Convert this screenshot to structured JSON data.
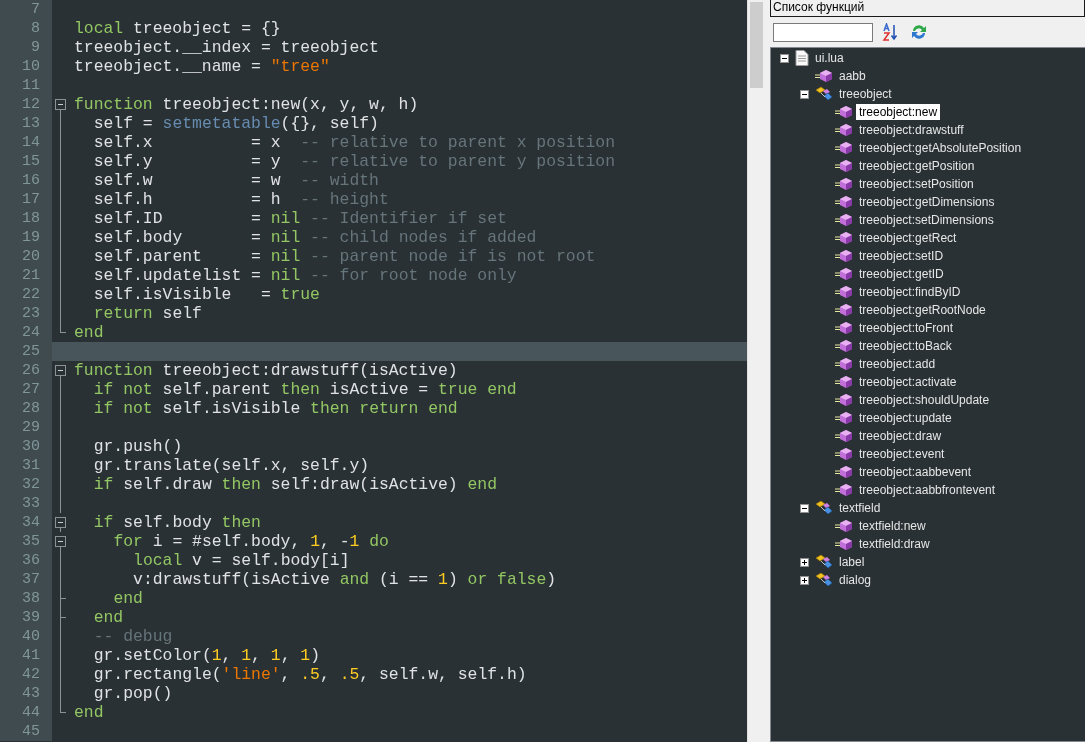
{
  "editor": {
    "lines": [
      {
        "number": "7",
        "current": false
      },
      {
        "number": "8",
        "current": false,
        "tokens": [
          {
            "kind": "kw",
            "text": "local"
          },
          {
            "kind": "plain",
            "text": " treeobject = {}"
          }
        ]
      },
      {
        "number": "9",
        "current": false,
        "tokens": [
          {
            "kind": "plain",
            "text": "treeobject.__index = treeobject"
          }
        ]
      },
      {
        "number": "10",
        "current": false,
        "tokens": [
          {
            "kind": "plain",
            "text": "treeobject.__name = "
          },
          {
            "kind": "str",
            "text": "\"tree\""
          }
        ]
      },
      {
        "number": "11",
        "current": false
      },
      {
        "number": "12",
        "current": false,
        "tokens": [
          {
            "kind": "kw",
            "text": "function"
          },
          {
            "kind": "plain",
            "text": " treeobject:new(x, y, w, h)"
          }
        ],
        "children": [
          {
            "number": "13",
            "current": false,
            "tokens": [
              {
                "kind": "plain",
                "text": "self = "
              },
              {
                "kind": "fn",
                "text": "setmetatable"
              },
              {
                "kind": "plain",
                "text": "({}, self)"
              }
            ]
          },
          {
            "number": "14",
            "current": false,
            "tokens": [
              {
                "kind": "plain",
                "text": "self.x          = x"
              },
              {
                "kind": "cmt",
                "text": "  -- relative to parent x position"
              }
            ]
          },
          {
            "number": "15",
            "current": false,
            "tokens": [
              {
                "kind": "plain",
                "text": "self.y          = y"
              },
              {
                "kind": "cmt",
                "text": "  -- relative to parent y position"
              }
            ]
          },
          {
            "number": "16",
            "current": false,
            "tokens": [
              {
                "kind": "plain",
                "text": "self.w          = w"
              },
              {
                "kind": "cmt",
                "text": "  -- width"
              }
            ]
          },
          {
            "number": "17",
            "current": false,
            "tokens": [
              {
                "kind": "plain",
                "text": "self.h          = h"
              },
              {
                "kind": "cmt",
                "text": "  -- height"
              }
            ]
          },
          {
            "number": "18",
            "current": false,
            "tokens": [
              {
                "kind": "plain",
                "text": "self.ID         = "
              },
              {
                "kind": "kw",
                "text": "nil"
              },
              {
                "kind": "cmt",
                "text": " -- Identifier if set"
              }
            ]
          },
          {
            "number": "19",
            "current": false,
            "tokens": [
              {
                "kind": "plain",
                "text": "self.body       = "
              },
              {
                "kind": "kw",
                "text": "nil"
              },
              {
                "kind": "cmt",
                "text": " -- child nodes if added"
              }
            ]
          },
          {
            "number": "20",
            "current": false,
            "tokens": [
              {
                "kind": "plain",
                "text": "self.parent     = "
              },
              {
                "kind": "kw",
                "text": "nil"
              },
              {
                "kind": "cmt",
                "text": " -- parent node if is not root"
              }
            ]
          },
          {
            "number": "21",
            "current": false,
            "tokens": [
              {
                "kind": "plain",
                "text": "self.updatelist = "
              },
              {
                "kind": "kw",
                "text": "nil"
              },
              {
                "kind": "cmt",
                "text": " -- for root node only"
              }
            ]
          },
          {
            "number": "22",
            "current": false,
            "tokens": [
              {
                "kind": "plain",
                "text": "self.isVisible   = "
              },
              {
                "kind": "kw",
                "text": "true"
              }
            ]
          },
          {
            "number": "23",
            "current": false,
            "tokens": [
              {
                "kind": "kw",
                "text": "return"
              },
              {
                "kind": "plain",
                "text": " self"
              }
            ]
          }
        ]
      },
      {
        "number": "24",
        "current": false,
        "tokens": [
          {
            "kind": "kw",
            "text": "end"
          }
        ]
      },
      {
        "number": "25",
        "current": true
      },
      {
        "number": "26",
        "current": false,
        "tokens": [
          {
            "kind": "kw",
            "text": "function"
          },
          {
            "kind": "plain",
            "text": " treeobject:drawstuff(isActive)"
          }
        ],
        "children": [
          {
            "number": "27",
            "current": false,
            "tokens": [
              {
                "kind": "kw",
                "text": "if not"
              },
              {
                "kind": "plain",
                "text": " self.parent "
              },
              {
                "kind": "kw",
                "text": "then"
              },
              {
                "kind": "plain",
                "text": " isActive = "
              },
              {
                "kind": "kw",
                "text": "true end"
              }
            ]
          },
          {
            "number": "28",
            "current": false,
            "tokens": [
              {
                "kind": "kw",
                "text": "if not"
              },
              {
                "kind": "plain",
                "text": " self.isVisible "
              },
              {
                "kind": "kw",
                "text": "then return end"
              }
            ]
          },
          {
            "number": "29",
            "current": false
          },
          {
            "number": "30",
            "current": false,
            "tokens": [
              {
                "kind": "plain",
                "text": "gr.push()"
              }
            ]
          },
          {
            "number": "31",
            "current": false,
            "tokens": [
              {
                "kind": "plain",
                "text": "gr.translate(self.x, self.y)"
              }
            ]
          },
          {
            "number": "32",
            "current": false,
            "tokens": [
              {
                "kind": "kw",
                "text": "if"
              },
              {
                "kind": "plain",
                "text": " self.draw "
              },
              {
                "kind": "kw",
                "text": "then"
              },
              {
                "kind": "plain",
                "text": " self:draw(isActive) "
              },
              {
                "kind": "kw",
                "text": "end"
              }
            ]
          },
          {
            "number": "33",
            "current": false
          },
          {
            "number": "34",
            "current": false,
            "tokens": [
              {
                "kind": "kw",
                "text": "if"
              },
              {
                "kind": "plain",
                "text": " self.body "
              },
              {
                "kind": "kw",
                "text": "then"
              }
            ],
            "children": [
              {
                "number": "35",
                "current": false,
                "tokens": [
                  {
                    "kind": "kw",
                    "text": "for"
                  },
                  {
                    "kind": "plain",
                    "text": " i = #self.body, "
                  },
                  {
                    "kind": "num",
                    "text": "1"
                  },
                  {
                    "kind": "plain",
                    "text": ", -"
                  },
                  {
                    "kind": "num",
                    "text": "1"
                  },
                  {
                    "kind": "kw",
                    "text": " do"
                  }
                ],
                "children": [
                  {
                    "number": "36",
                    "current": false,
                    "tokens": [
                      {
                        "kind": "kw",
                        "text": "local"
                      },
                      {
                        "kind": "plain",
                        "text": " v = self.body[i]"
                      }
                    ]
                  },
                  {
                    "number": "37",
                    "current": false,
                    "tokens": [
                      {
                        "kind": "plain",
                        "text": "v:drawstuff(isActive "
                      },
                      {
                        "kind": "kw",
                        "text": "and"
                      },
                      {
                        "kind": "plain",
                        "text": " (i == "
                      },
                      {
                        "kind": "num",
                        "text": "1"
                      },
                      {
                        "kind": "plain",
                        "text": ") "
                      },
                      {
                        "kind": "kw",
                        "text": "or false"
                      },
                      {
                        "kind": "plain",
                        "text": ")"
                      }
                    ]
                  }
                ]
              },
              {
                "number": "38",
                "current": false,
                "tokens": [
                  {
                    "kind": "kw",
                    "text": "end"
                  }
                ]
              }
            ]
          },
          {
            "number": "39",
            "current": false,
            "tokens": [
              {
                "kind": "kw",
                "text": "end"
              }
            ]
          },
          {
            "number": "40",
            "current": false,
            "tokens": [
              {
                "kind": "cmt",
                "text": "-- debug"
              }
            ]
          },
          {
            "number": "41",
            "current": false,
            "tokens": [
              {
                "kind": "plain",
                "text": "gr.setColor("
              },
              {
                "kind": "num",
                "text": "1"
              },
              {
                "kind": "plain",
                "text": ", "
              },
              {
                "kind": "num",
                "text": "1"
              },
              {
                "kind": "plain",
                "text": ", "
              },
              {
                "kind": "num",
                "text": "1"
              },
              {
                "kind": "plain",
                "text": ", "
              },
              {
                "kind": "num",
                "text": "1"
              },
              {
                "kind": "plain",
                "text": ")"
              }
            ]
          },
          {
            "number": "42",
            "current": false,
            "tokens": [
              {
                "kind": "plain",
                "text": "gr.rectangle("
              },
              {
                "kind": "str",
                "text": "'line'"
              },
              {
                "kind": "plain",
                "text": ", "
              },
              {
                "kind": "num",
                "text": ".5"
              },
              {
                "kind": "plain",
                "text": ", "
              },
              {
                "kind": "num",
                "text": ".5"
              },
              {
                "kind": "plain",
                "text": ", self.w, self.h)"
              }
            ]
          },
          {
            "number": "43",
            "current": false,
            "tokens": [
              {
                "kind": "plain",
                "text": "gr.pop()"
              }
            ]
          }
        ]
      },
      {
        "number": "44",
        "current": false,
        "tokens": [
          {
            "kind": "kw",
            "text": "end"
          }
        ]
      },
      {
        "number": "45",
        "current": false
      }
    ]
  },
  "function_list": {
    "title": "Список функций",
    "tree": [
      {
        "kind": "file",
        "label": "ui.lua",
        "selected": false,
        "expanded": true,
        "children": [
          {
            "kind": "function",
            "label": "aabb",
            "selected": false
          },
          {
            "kind": "class",
            "label": "treeobject",
            "selected": false,
            "expanded": true,
            "children": [
              {
                "kind": "function",
                "label": "treeobject:new",
                "selected": true
              },
              {
                "kind": "function",
                "label": "treeobject:drawstuff",
                "selected": false
              },
              {
                "kind": "function",
                "label": "treeobject:getAbsolutePosition",
                "selected": false
              },
              {
                "kind": "function",
                "label": "treeobject:getPosition",
                "selected": false
              },
              {
                "kind": "function",
                "label": "treeobject:setPosition",
                "selected": false
              },
              {
                "kind": "function",
                "label": "treeobject:getDimensions",
                "selected": false
              },
              {
                "kind": "function",
                "label": "treeobject:setDimensions",
                "selected": false
              },
              {
                "kind": "function",
                "label": "treeobject:getRect",
                "selected": false
              },
              {
                "kind": "function",
                "label": "treeobject:setID",
                "selected": false
              },
              {
                "kind": "function",
                "label": "treeobject:getID",
                "selected": false
              },
              {
                "kind": "function",
                "label": "treeobject:findByID",
                "selected": false
              },
              {
                "kind": "function",
                "label": "treeobject:getRootNode",
                "selected": false
              },
              {
                "kind": "function",
                "label": "treeobject:toFront",
                "selected": false
              },
              {
                "kind": "function",
                "label": "treeobject:toBack",
                "selected": false
              },
              {
                "kind": "function",
                "label": "treeobject:add",
                "selected": false
              },
              {
                "kind": "function",
                "label": "treeobject:activate",
                "selected": false
              },
              {
                "kind": "function",
                "label": "treeobject:shouldUpdate",
                "selected": false
              },
              {
                "kind": "function",
                "label": "treeobject:update",
                "selected": false
              },
              {
                "kind": "function",
                "label": "treeobject:draw",
                "selected": false
              },
              {
                "kind": "function",
                "label": "treeobject:event",
                "selected": false
              },
              {
                "kind": "function",
                "label": "treeobject:aabbevent",
                "selected": false
              },
              {
                "kind": "function",
                "label": "treeobject:aabbfrontevent",
                "selected": false
              }
            ]
          },
          {
            "kind": "class",
            "label": "textfield",
            "selected": false,
            "expanded": true,
            "children": [
              {
                "kind": "function",
                "label": "textfield:new",
                "selected": false
              },
              {
                "kind": "function",
                "label": "textfield:draw",
                "selected": false
              }
            ]
          },
          {
            "kind": "class",
            "label": "label",
            "selected": false,
            "expanded": false
          },
          {
            "kind": "class",
            "label": "dialog",
            "selected": false,
            "expanded": false
          }
        ]
      }
    ]
  }
}
